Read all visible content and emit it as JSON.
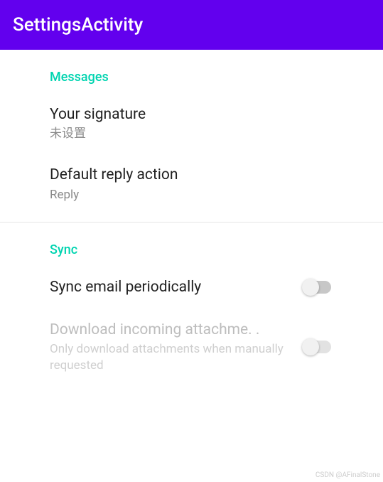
{
  "appbar": {
    "title": "SettingsActivity"
  },
  "sections": {
    "messages": {
      "header": "Messages",
      "signature": {
        "title": "Your signature",
        "summary": "未设置"
      },
      "reply_action": {
        "title": "Default reply action",
        "summary": "Reply"
      }
    },
    "sync": {
      "header": "Sync",
      "periodic": {
        "title": "Sync email periodically",
        "checked": false
      },
      "attachments": {
        "title": "Download incoming attachme. .",
        "summary": "Only download attachments when manually requested",
        "checked": false,
        "enabled": false
      }
    }
  },
  "watermark": "CSDN @AFinalStone"
}
